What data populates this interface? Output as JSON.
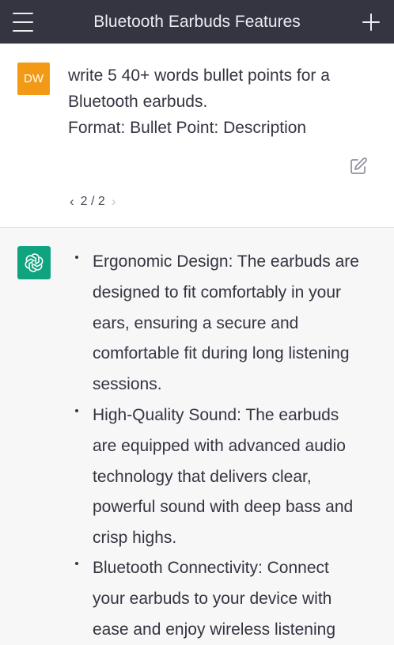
{
  "header": {
    "title": "Bluetooth Earbuds Features",
    "menu_icon": "hamburger-menu-icon",
    "new_chat_icon": "plus-icon"
  },
  "user_message": {
    "avatar_initials": "DW",
    "avatar_color": "#f29a16",
    "lines": [
      "write 5 40+ words bullet points for a",
      "Bluetooth earbuds.",
      "Format: Bullet Point: Description"
    ],
    "edit_icon": "edit-icon",
    "pager": {
      "prev": "‹",
      "label": "2 / 2",
      "next": "›"
    }
  },
  "assistant_message": {
    "avatar_icon": "openai-logo-icon",
    "avatar_color": "#10a37f",
    "bullets": [
      {
        "lines": [
          "Ergonomic Design: The earbuds are",
          "designed to fit comfortably in your",
          "ears, ensuring a secure and",
          "comfortable fit during long listening",
          "sessions."
        ]
      },
      {
        "lines": [
          "High-Quality Sound: The earbuds",
          "are equipped with advanced audio",
          "technology that delivers clear,",
          "powerful sound with deep bass and",
          "crisp highs."
        ]
      },
      {
        "lines": [
          "Bluetooth Connectivity: Connect",
          "your earbuds to your device with",
          "ease and enjoy wireless listening"
        ]
      }
    ]
  }
}
